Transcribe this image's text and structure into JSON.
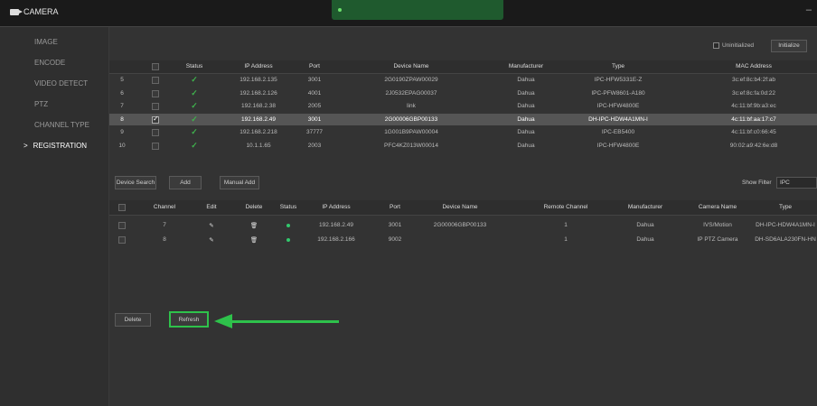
{
  "header": {
    "title": "CAMERA"
  },
  "sidebar": {
    "items": [
      {
        "label": "IMAGE"
      },
      {
        "label": "ENCODE"
      },
      {
        "label": "VIDEO DETECT"
      },
      {
        "label": "PTZ"
      },
      {
        "label": "CHANNEL TYPE"
      },
      {
        "label": "REGISTRATION",
        "active": true
      }
    ]
  },
  "init": {
    "uninit_label": "Uninitialized",
    "init_button": "Initialize"
  },
  "device_table": {
    "headers": [
      "Status",
      "IP Address",
      "Port",
      "Device Name",
      "Manufacturer",
      "Type",
      "MAC Address"
    ],
    "rows": [
      {
        "no": "5",
        "ip": "192.168.2.135",
        "port": "3001",
        "name": "2G0190ZPAW00029",
        "manu": "Dahua",
        "type": "IPC-HFW5331E-Z",
        "mac": "3c:ef:8c:b4:2f:ab"
      },
      {
        "no": "6",
        "ip": "192.168.2.126",
        "port": "4001",
        "name": "2J0532EPAG00037",
        "manu": "Dahua",
        "type": "IPC-PFW8601-A180",
        "mac": "3c:ef:8c:fa:0d:22"
      },
      {
        "no": "7",
        "ip": "192.168.2.38",
        "port": "2005",
        "name": "link",
        "manu": "Dahua",
        "type": "IPC-HFW4800E",
        "mac": "4c:11:bf:9b:a3:ec"
      },
      {
        "no": "8",
        "ip": "192.168.2.49",
        "port": "3001",
        "name": "2G00006GBP00133",
        "manu": "Dahua",
        "type": "DH-IPC-HDW4A1MN-I",
        "mac": "4c:11:bf:aa:17:c7",
        "selected": true
      },
      {
        "no": "9",
        "ip": "192.168.2.218",
        "port": "37777",
        "name": "1G001B9PAW00004",
        "manu": "Dahua",
        "type": "IPC-EB5400",
        "mac": "4c:11:bf:c0:66:45"
      },
      {
        "no": "10",
        "ip": "10.1.1.65",
        "port": "2003",
        "name": "PFC4KZ013W00014",
        "manu": "Dahua",
        "type": "IPC-HFW4800E",
        "mac": "90:02:a9:42:6e:d8"
      }
    ]
  },
  "toolbar": {
    "device_search": "Device Search",
    "add": "Add",
    "manual_add": "Manual Add",
    "show_filter": "Show Filter",
    "filter_value": "IPC"
  },
  "added_table": {
    "headers": [
      "Channel",
      "Edit",
      "Delete",
      "Status",
      "IP Address",
      "Port",
      "Device Name",
      "Remote Channel",
      "Manufacturer",
      "Camera Name",
      "Type"
    ],
    "rows": [
      {
        "channel": "7",
        "ip": "192.168.2.49",
        "port": "3001",
        "name": "2G00006GBP00133",
        "remote": "1",
        "manu": "Dahua",
        "cam": "IVS/Motion",
        "type": "DH-IPC-HDW4A1MN-I"
      },
      {
        "channel": "8",
        "ip": "192.168.2.166",
        "port": "9002",
        "name": "",
        "remote": "1",
        "manu": "Dahua",
        "cam": "IP PTZ Camera",
        "type": "DH-SD6ALA230FN-HN"
      }
    ]
  },
  "bottom": {
    "delete": "Delete",
    "refresh": "Refresh"
  },
  "colors": {
    "accent": "#2ec24b",
    "status_ok": "#32c86c"
  }
}
